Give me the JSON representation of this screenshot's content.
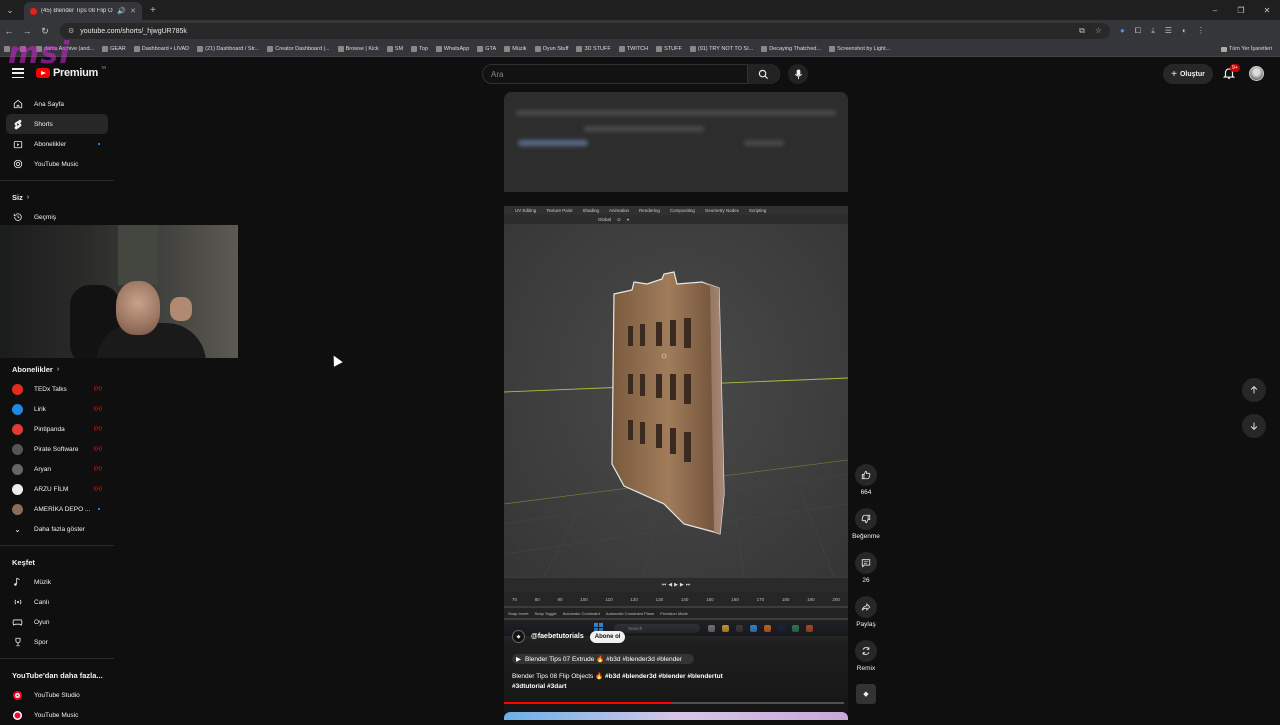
{
  "browser": {
    "tab_title": "(45) Blender Tips 08 Flip Ol",
    "url": "youtube.com/shorts/_hjwgUR785k",
    "bookmarks": [
      "",
      "",
      "dams Archive (and...",
      "GEAR",
      "Dashboard • LIVAD",
      "(21) Dashboard / Str...",
      "Creator Dashboard |...",
      "Browse | Kick",
      "SM",
      "Top",
      "WhatsApp",
      "GTA",
      "Müzik",
      "Oyun Stuff",
      "3D STUFF",
      "TWITCH",
      "STUFF",
      "(91) TRY NOT TO SI...",
      "Decaying Thatched...",
      "Screenshot by Light..."
    ],
    "all_bookmarks_label": "Tüm Yer İşaretleri"
  },
  "watermark": "msi",
  "header": {
    "logo_text": "Premium",
    "logo_sup": "TR",
    "search_placeholder": "Ara",
    "create_label": "Oluştur",
    "notification_count": "9+"
  },
  "sidebar": {
    "main_items": [
      {
        "label": "Ana Sayfa",
        "icon": "home-icon"
      },
      {
        "label": "Shorts",
        "icon": "shorts-icon"
      },
      {
        "label": "Abonelikler",
        "icon": "subscriptions-icon"
      },
      {
        "label": "YouTube Music",
        "icon": "music-icon"
      }
    ],
    "you_heading": "Siz",
    "history_label": "Geçmiş",
    "subs_heading": "Abonelikler",
    "subscriptions": [
      {
        "label": "TEDx Talks",
        "color": "#e62b1e"
      },
      {
        "label": "Lirik",
        "color": "#1e88e5"
      },
      {
        "label": "Pintipanda",
        "color": "#e53935"
      },
      {
        "label": "Pirate Software",
        "color": "#555555"
      },
      {
        "label": "Aryan",
        "color": "#666666"
      },
      {
        "label": "ARZU FİLM",
        "color": "#eeeeee"
      },
      {
        "label": "AMERİKA DEPO ...",
        "color": "#8a6d5a"
      }
    ],
    "show_more": "Daha fazla göster",
    "explore_heading": "Keşfet",
    "explore_items": [
      {
        "label": "Müzik",
        "icon": "music-note-icon"
      },
      {
        "label": "Canlı",
        "icon": "live-icon"
      },
      {
        "label": "Oyun",
        "icon": "gaming-icon"
      },
      {
        "label": "Spor",
        "icon": "trophy-icon"
      }
    ],
    "more_heading": "YouTube'dan daha fazla...",
    "more_items": [
      {
        "label": "YouTube Studio"
      },
      {
        "label": "YouTube Music"
      }
    ]
  },
  "short": {
    "blender_tabs": [
      "UV Editing",
      "Texture Paint",
      "Shading",
      "Animation",
      "Rendering",
      "Compositing",
      "Geometry Nodes",
      "Scripting"
    ],
    "blender_sub": "Global",
    "ruler_ticks": [
      "70",
      "80",
      "90",
      "100",
      "110",
      "120",
      "130",
      "140",
      "150",
      "160",
      "170",
      "180",
      "190",
      "200"
    ],
    "status_items": [
      "Snap Invert",
      "Snap Toggle",
      "Automatic Constraint",
      "Automatic Constraint Plane",
      "Precision Mode"
    ],
    "taskbar_search": "Search",
    "channel_handle": "@faebetutorials",
    "subscribe_label": "Abone ol",
    "playlist_label": "Blender Tips 07 Extrude 🔥 #b3d #blender3d #blender",
    "caption_text": "Blender Tips 08 Flip Objects 🔥",
    "caption_tags_line1": "#b3d #blender3d #blender #blendertut",
    "caption_tags_line2": "#3dtutorial #3dart",
    "progress": 0.49
  },
  "actions": {
    "like_count": "664",
    "dislike_label": "Beğenme",
    "comment_count": "26",
    "share_label": "Paylaş",
    "remix_label": "Remix"
  },
  "colors": {
    "accent": "#ff0000",
    "background": "#0f0f0f"
  }
}
